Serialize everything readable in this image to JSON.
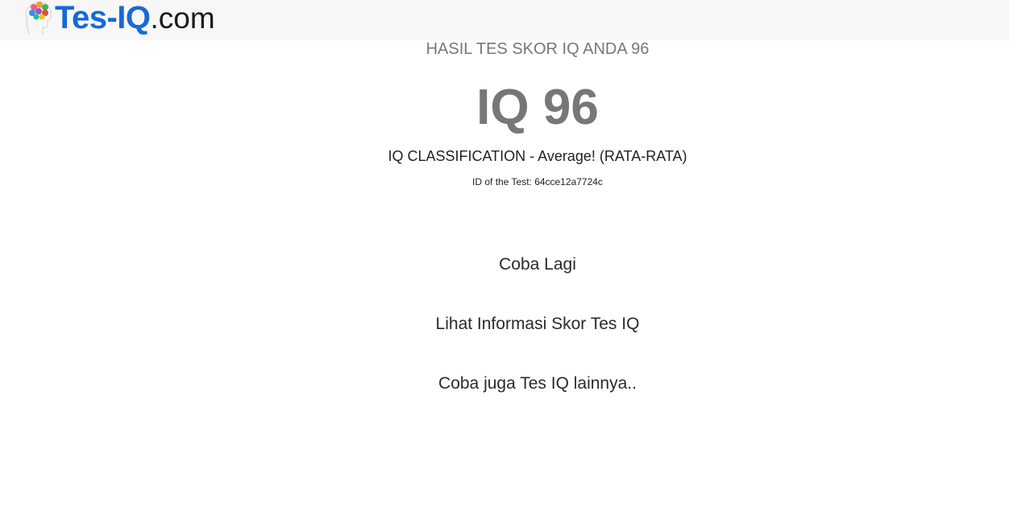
{
  "header": {
    "logo": {
      "brand": "Tes-IQ",
      "tld": ".com",
      "icon": "brain-head-icon"
    }
  },
  "result": {
    "heading": "HASIL TES SKOR IQ ANDA 96",
    "score_text": "IQ 96",
    "classification": "IQ CLASSIFICATION - Average! (RATA-RATA)",
    "test_id": "ID of the Test: 64cce12a7724c"
  },
  "links": {
    "retry": "Coba Lagi",
    "info": "Lihat Informasi Skor Tes IQ",
    "other": "Coba juga Tes IQ lainnya.."
  },
  "colors": {
    "brand_blue": "#1769d8",
    "header_bg": "#f7f7f7",
    "muted_gray": "#777777",
    "text_dark": "#222222"
  }
}
